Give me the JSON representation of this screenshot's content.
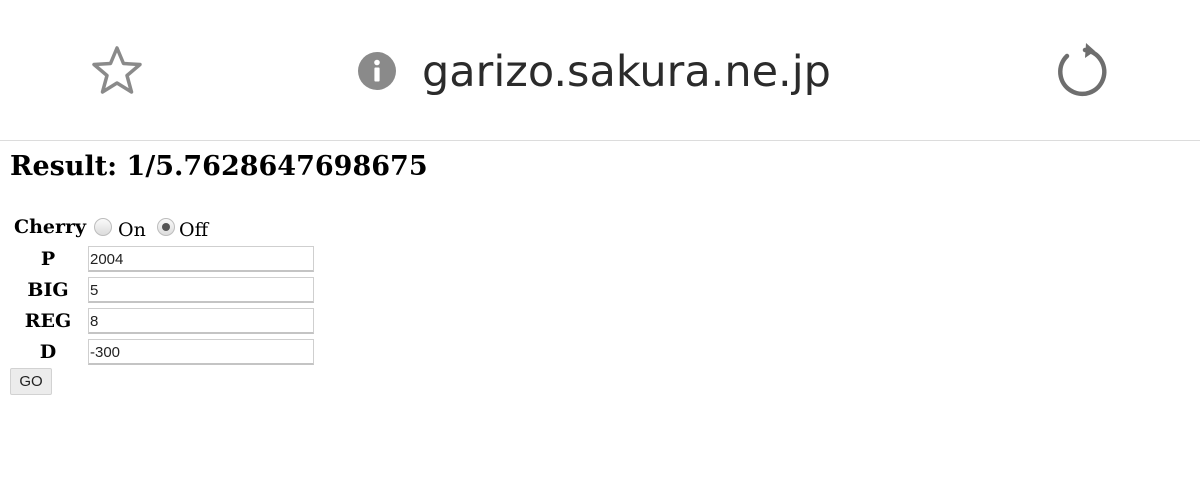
{
  "browser": {
    "url": "garizo.sakura.ne.jp",
    "icons": {
      "bookmark": "star-icon",
      "site_info": "info-icon",
      "reload": "reload-icon"
    }
  },
  "page": {
    "result_text": "Result: 1/5.7628647698675",
    "cherry": {
      "label": "Cherry",
      "options": [
        {
          "label": "On",
          "checked": false
        },
        {
          "label": "Off",
          "checked": true
        }
      ]
    },
    "fields": [
      {
        "label": "P",
        "value": "2004"
      },
      {
        "label": "BIG",
        "value": "5"
      },
      {
        "label": "REG",
        "value": "8"
      },
      {
        "label": "D",
        "value": "-300"
      }
    ],
    "submit_label": "GO"
  },
  "colors": {
    "icon_gray": "#8a8a8a",
    "text": "#2b2b2b",
    "divider": "#dcdcdc"
  }
}
